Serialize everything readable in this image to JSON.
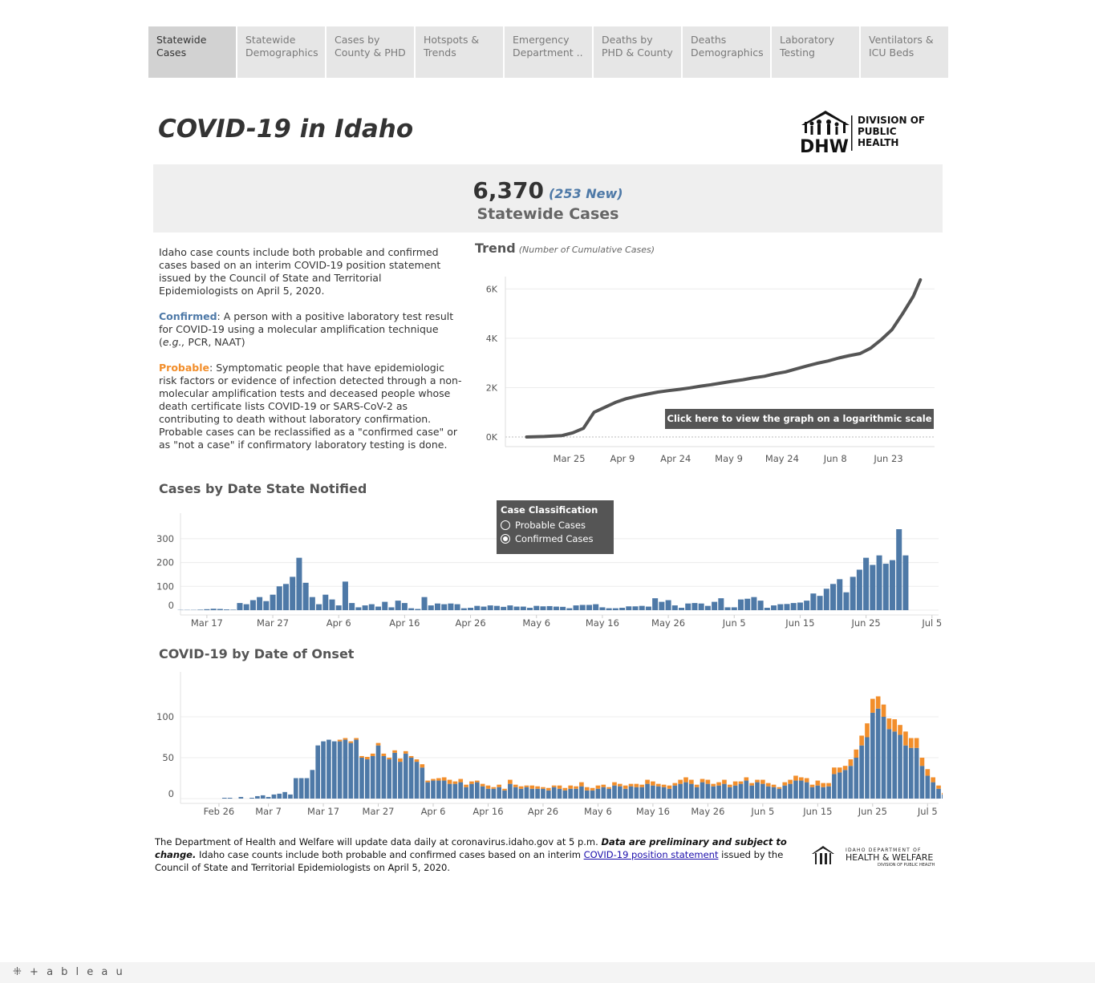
{
  "tabs": [
    {
      "label": "Statewide Cases",
      "active": true
    },
    {
      "label": "Statewide Demographics"
    },
    {
      "label": "Cases by County & PHD"
    },
    {
      "label": "Hotspots & Trends"
    },
    {
      "label": "Emergency Department .."
    },
    {
      "label": "Deaths by PHD & County"
    },
    {
      "label": "Deaths Demographics"
    },
    {
      "label": "Laboratory Testing"
    },
    {
      "label": "Ventilators & ICU Beds"
    }
  ],
  "header": {
    "title": "COVID-19 in Idaho",
    "logo": {
      "abbr": "DHW",
      "lines": [
        "DIVISION OF",
        "PUBLIC",
        "HEALTH"
      ]
    }
  },
  "summary": {
    "total": "6,370",
    "new": "(253 New)",
    "label": "Statewide Cases"
  },
  "description": {
    "intro": "Idaho case counts include both probable and confirmed cases based on an interim COVID-19 position statement issued by the Council of State and Territorial Epidemiologists on April 5, 2020.",
    "confirmed_label": "Confirmed",
    "confirmed_text_1": ": A person with a positive laboratory test result for COVID-19 using a molecular amplification technique (",
    "confirmed_eg": "e.g.,",
    "confirmed_text_2": " PCR, NAAT)",
    "probable_label": "Probable",
    "probable_text": ": Symptomatic people that have epidemiologic risk factors or evidence of infection detected through a non-molecular amplification tests and deceased people whose death certificate lists  COVID-19 or SARS-CoV-2 as contributing to death without laboratory confirmation. Probable cases can be reclassified as a \"confirmed case\" or as \"not a case\" if confirmatory laboratory testing is done."
  },
  "trend": {
    "title": "Trend",
    "subtitle": "(Number of Cumulative Cases)",
    "log_button": "Click here to view the graph on a logarithmic scale"
  },
  "notified": {
    "title": "Cases by Date State Notified"
  },
  "legend": {
    "title": "Case Classification",
    "options": [
      {
        "label": "Probable Cases",
        "selected": false
      },
      {
        "label": "Confirmed Cases",
        "selected": true
      }
    ]
  },
  "onset": {
    "title": "COVID-19 by Date of Onset"
  },
  "colors": {
    "confirmed": "#4e79a7",
    "probable": "#f28e2b",
    "line": "#555555"
  },
  "footer": {
    "text_1": "The Department of Health and Welfare will update data daily at coronavirus.idaho.gov at 5 p.m. ",
    "bold": "Data are preliminary and subject to change.",
    "text_2": " Idaho case counts include both probable and confirmed cases based on an interim ",
    "link": "COVID-19 position statement",
    "text_3": " issued by the Council of State and Territorial Epidemiologists on April 5, 2020.",
    "logo_line1": "IDAHO DEPARTMENT OF",
    "logo_line2": "HEALTH & WELFARE",
    "logo_line3": "DIVISION OF PUBLIC HEALTH"
  },
  "tableau_label": "+ a b l e a u",
  "chart_data": [
    {
      "id": "trend",
      "type": "line",
      "title": "Trend",
      "subtitle": "(Number of Cumulative Cases)",
      "x_ticks": [
        "Mar 25",
        "Apr 9",
        "Apr 24",
        "May 9",
        "May 24",
        "Jun 8",
        "Jun 23"
      ],
      "y_ticks": [
        "0K",
        "2K",
        "4K",
        "6K"
      ],
      "ylim": [
        0,
        6500
      ],
      "x": [
        "Mar 13",
        "Mar 18",
        "Mar 23",
        "Mar 26",
        "Mar 29",
        "Apr 1",
        "Apr 4",
        "Apr 7",
        "Apr 10",
        "Apr 13",
        "Apr 16",
        "Apr 19",
        "Apr 22",
        "Apr 25",
        "Apr 28",
        "May 1",
        "May 4",
        "May 7",
        "May 10",
        "May 13",
        "May 16",
        "May 19",
        "May 22",
        "May 25",
        "May 28",
        "May 31",
        "Jun 3",
        "Jun 6",
        "Jun 9",
        "Jun 12",
        "Jun 15",
        "Jun 18",
        "Jun 21",
        "Jun 24",
        "Jun 27",
        "Jun 30",
        "Jul 2"
      ],
      "values": [
        0,
        20,
        60,
        170,
        350,
        1000,
        1200,
        1400,
        1550,
        1650,
        1740,
        1820,
        1880,
        1930,
        1990,
        2060,
        2120,
        2190,
        2260,
        2320,
        2400,
        2460,
        2560,
        2640,
        2760,
        2880,
        2990,
        3080,
        3200,
        3300,
        3380,
        3600,
        3950,
        4350,
        5000,
        5700,
        6370
      ]
    },
    {
      "id": "notified",
      "type": "bar",
      "title": "Cases by Date State Notified",
      "x_ticks": [
        "Mar 17",
        "Mar 27",
        "Apr 6",
        "Apr 16",
        "Apr 26",
        "May 6",
        "May 16",
        "May 26",
        "Jun 5",
        "Jun 15",
        "Jun 25",
        "Jul 5"
      ],
      "x_start": "Mar 13",
      "x_end": "Jul 6",
      "y_ticks": [
        0,
        100,
        200,
        300
      ],
      "ylim": [
        0,
        340
      ],
      "series": [
        {
          "name": "Confirmed Cases",
          "values": [
            1,
            1,
            1,
            2,
            4,
            6,
            5,
            3,
            2,
            30,
            25,
            42,
            55,
            38,
            65,
            100,
            110,
            140,
            220,
            115,
            55,
            25,
            65,
            45,
            20,
            120,
            30,
            12,
            20,
            25,
            15,
            35,
            12,
            40,
            30,
            8,
            5,
            55,
            20,
            28,
            25,
            28,
            25,
            8,
            10,
            18,
            15,
            20,
            18,
            14,
            20,
            15,
            15,
            10,
            18,
            16,
            17,
            15,
            14,
            8,
            20,
            22,
            22,
            25,
            12,
            8,
            8,
            10,
            16,
            16,
            18,
            15,
            50,
            35,
            42,
            20,
            10,
            28,
            30,
            28,
            18,
            35,
            50,
            12,
            12,
            45,
            48,
            55,
            40,
            10,
            20,
            25,
            26,
            30,
            32,
            40,
            70,
            60,
            90,
            110,
            130,
            75,
            140,
            170,
            220,
            190,
            230,
            195,
            210,
            340,
            230
          ]
        }
      ]
    },
    {
      "id": "onset",
      "type": "bar",
      "title": "COVID-19 by Date of Onset",
      "x_ticks": [
        "Feb 26",
        "Mar 7",
        "Mar 17",
        "Mar 27",
        "Apr 6",
        "Apr 16",
        "Apr 26",
        "May 6",
        "May 16",
        "May 26",
        "Jun 5",
        "Jun 15",
        "Jun 25",
        "Jul 5"
      ],
      "x_start": "Feb 19",
      "x_end": "Jul 7",
      "y_ticks": [
        0,
        50,
        100
      ],
      "ylim": [
        0,
        150
      ],
      "series": [
        {
          "name": "Confirmed Cases",
          "values": [
            0,
            0,
            0,
            0,
            0,
            0,
            0,
            0,
            1,
            1,
            0,
            2,
            0,
            1,
            3,
            4,
            2,
            5,
            6,
            8,
            5,
            25,
            25,
            25,
            35,
            65,
            70,
            72,
            70,
            70,
            72,
            68,
            72,
            50,
            48,
            52,
            65,
            52,
            48,
            56,
            45,
            55,
            50,
            45,
            38,
            20,
            22,
            22,
            22,
            18,
            18,
            20,
            14,
            18,
            20,
            15,
            12,
            12,
            14,
            10,
            18,
            14,
            12,
            14,
            12,
            12,
            12,
            10,
            14,
            12,
            10,
            12,
            12,
            15,
            10,
            10,
            12,
            14,
            12,
            16,
            15,
            12,
            15,
            14,
            14,
            18,
            16,
            15,
            14,
            12,
            16,
            18,
            20,
            18,
            14,
            20,
            18,
            15,
            16,
            18,
            14,
            16,
            18,
            22,
            16,
            20,
            18,
            15,
            14,
            12,
            16,
            18,
            22,
            22,
            20,
            14,
            16,
            14,
            15,
            30,
            32,
            35,
            40,
            50,
            65,
            75,
            105,
            110,
            100,
            85,
            82,
            78,
            65,
            62,
            62,
            40,
            28,
            20,
            12,
            5,
            2,
            1
          ]
        },
        {
          "name": "Probable Cases",
          "values": [
            0,
            0,
            0,
            0,
            0,
            0,
            0,
            0,
            0,
            0,
            0,
            0,
            0,
            0,
            0,
            0,
            0,
            0,
            0,
            0,
            0,
            0,
            0,
            0,
            0,
            0,
            0,
            0,
            0,
            2,
            2,
            2,
            2,
            2,
            3,
            3,
            3,
            3,
            2,
            3,
            4,
            3,
            2,
            3,
            4,
            2,
            2,
            3,
            4,
            5,
            3,
            4,
            3,
            3,
            2,
            3,
            4,
            2,
            3,
            2,
            5,
            3,
            3,
            2,
            4,
            3,
            2,
            3,
            2,
            4,
            3,
            4,
            3,
            5,
            4,
            3,
            4,
            3,
            2,
            4,
            3,
            4,
            3,
            4,
            3,
            5,
            5,
            3,
            3,
            4,
            3,
            5,
            6,
            5,
            3,
            4,
            5,
            3,
            4,
            5,
            3,
            5,
            3,
            4,
            3,
            3,
            5,
            4,
            3,
            2,
            4,
            5,
            6,
            4,
            5,
            3,
            6,
            5,
            4,
            8,
            6,
            5,
            8,
            10,
            12,
            17,
            17,
            15,
            15,
            13,
            15,
            12,
            17,
            12,
            12,
            10,
            8,
            6,
            4,
            2,
            1,
            1
          ]
        }
      ]
    }
  ]
}
